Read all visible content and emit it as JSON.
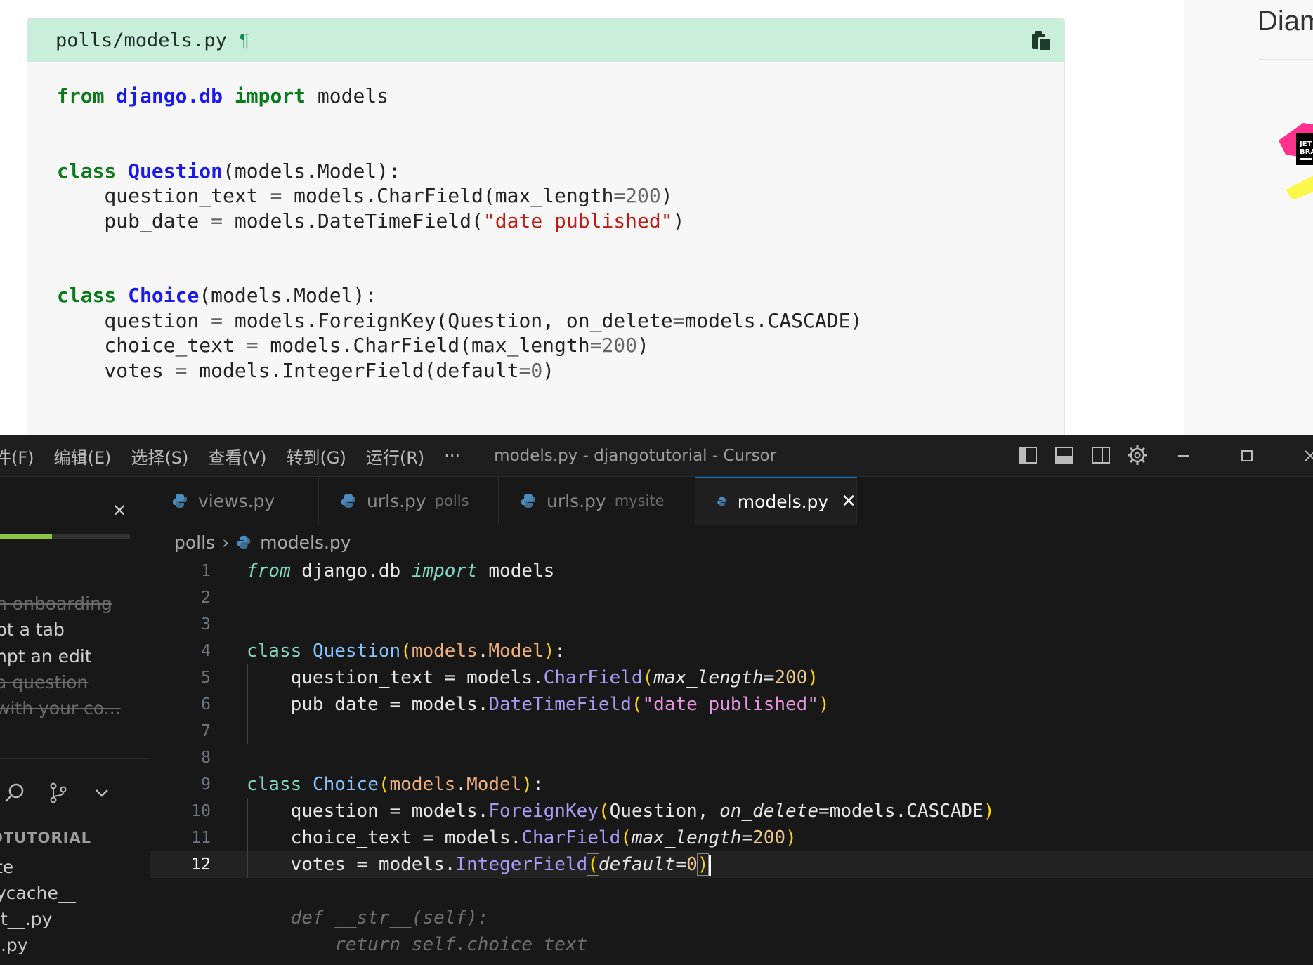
{
  "docs": {
    "snippet_filename": "polls/models.py",
    "pilcrow": "¶",
    "code_lines": [
      [
        {
          "t": "from",
          "c": "d-kw"
        },
        {
          "t": " "
        },
        {
          "t": "django.db",
          "c": "d-name"
        },
        {
          "t": " "
        },
        {
          "t": "import",
          "c": "d-kw"
        },
        {
          "t": " models"
        }
      ],
      [],
      [],
      [
        {
          "t": "class",
          "c": "d-kw"
        },
        {
          "t": " "
        },
        {
          "t": "Question",
          "c": "d-name"
        },
        {
          "t": "(models.Model):"
        }
      ],
      [
        {
          "t": "    question_text "
        },
        {
          "t": "=",
          "c": "d-op"
        },
        {
          "t": " models.CharField(max_length"
        },
        {
          "t": "=",
          "c": "d-op"
        },
        {
          "t": "200",
          "c": "d-num"
        },
        {
          "t": ")"
        }
      ],
      [
        {
          "t": "    pub_date "
        },
        {
          "t": "=",
          "c": "d-op"
        },
        {
          "t": " models.DateTimeField("
        },
        {
          "t": "\"date published\"",
          "c": "d-str"
        },
        {
          "t": ")"
        }
      ],
      [],
      [],
      [
        {
          "t": "class",
          "c": "d-kw"
        },
        {
          "t": " "
        },
        {
          "t": "Choice",
          "c": "d-name"
        },
        {
          "t": "(models.Model):"
        }
      ],
      [
        {
          "t": "    question "
        },
        {
          "t": "=",
          "c": "d-op"
        },
        {
          "t": " models.ForeignKey(Question, on_delete"
        },
        {
          "t": "=",
          "c": "d-op"
        },
        {
          "t": "models.CASCADE)"
        }
      ],
      [
        {
          "t": "    choice_text "
        },
        {
          "t": "=",
          "c": "d-op"
        },
        {
          "t": " models.CharField(max_length"
        },
        {
          "t": "=",
          "c": "d-op"
        },
        {
          "t": "200",
          "c": "d-num"
        },
        {
          "t": ")"
        }
      ],
      [
        {
          "t": "    votes "
        },
        {
          "t": "=",
          "c": "d-op"
        },
        {
          "t": " models.IntegerField(default"
        },
        {
          "t": "=",
          "c": "d-op"
        },
        {
          "t": "0",
          "c": "d-num"
        },
        {
          "t": ")"
        }
      ]
    ],
    "right_title": "Diam"
  },
  "editor": {
    "menus": [
      "件(F)",
      "编辑(E)",
      "选择(S)",
      "查看(V)",
      "转到(G)",
      "运行(R)",
      "···"
    ],
    "window_title": "models.py - djangotutorial - Cursor",
    "sidebar": {
      "onboarding": [
        {
          "label": "h onboarding",
          "done": true
        },
        {
          "label": "pt a tab",
          "done": false
        },
        {
          "label": "npt an edit",
          "done": false
        },
        {
          "label": "a question",
          "done": true
        },
        {
          "label": " with your co...",
          "done": true
        }
      ],
      "progress": 0.4,
      "explorer_title": "OTUTORIAL",
      "tree": [
        "te",
        "ycache__",
        "it__.py",
        "i.py"
      ]
    },
    "tabs": [
      {
        "label": "views.py",
        "desc": "",
        "active": false
      },
      {
        "label": "urls.py",
        "desc": "polls",
        "active": false
      },
      {
        "label": "urls.py",
        "desc": "mysite",
        "active": false
      },
      {
        "label": "models.py",
        "desc": "",
        "active": true
      }
    ],
    "tab_close": "✕",
    "breadcrumb": {
      "folder": "polls",
      "file": "models.py"
    },
    "lines": [
      {
        "n": "1",
        "segs": [
          {
            "t": "from",
            "c": "e-kw-i"
          },
          {
            "t": " django.db "
          },
          {
            "t": "import",
            "c": "e-kw-i"
          },
          {
            "t": " models"
          }
        ]
      },
      {
        "n": "2",
        "segs": []
      },
      {
        "n": "3",
        "segs": []
      },
      {
        "n": "4",
        "segs": [
          {
            "t": "class",
            "c": "e-kw"
          },
          {
            "t": " "
          },
          {
            "t": "Question",
            "c": "e-cls"
          },
          {
            "t": "(",
            "c": "e-par"
          },
          {
            "t": "models",
            "c": "e-mod"
          },
          {
            "t": "."
          },
          {
            "t": "Model",
            "c": "e-mod"
          },
          {
            "t": ")",
            "c": "e-par"
          },
          {
            "t": ":"
          }
        ]
      },
      {
        "n": "5",
        "segs": [
          {
            "t": "    question_text = models."
          },
          {
            "t": "CharField",
            "c": "e-fn"
          },
          {
            "t": "(",
            "c": "e-par"
          },
          {
            "t": "max_length",
            "c": "e-kwarg"
          },
          {
            "t": "="
          },
          {
            "t": "200",
            "c": "e-num"
          },
          {
            "t": ")",
            "c": "e-par"
          }
        ]
      },
      {
        "n": "6",
        "segs": [
          {
            "t": "    pub_date = models."
          },
          {
            "t": "DateTimeField",
            "c": "e-fn"
          },
          {
            "t": "(",
            "c": "e-par"
          },
          {
            "t": "\"date published\"",
            "c": "e-str"
          },
          {
            "t": ")",
            "c": "e-par"
          }
        ]
      },
      {
        "n": "7",
        "segs": []
      },
      {
        "n": "8",
        "segs": []
      },
      {
        "n": "9",
        "segs": [
          {
            "t": "class",
            "c": "e-kw"
          },
          {
            "t": " "
          },
          {
            "t": "Choice",
            "c": "e-cls"
          },
          {
            "t": "(",
            "c": "e-par"
          },
          {
            "t": "models",
            "c": "e-mod"
          },
          {
            "t": "."
          },
          {
            "t": "Model",
            "c": "e-mod"
          },
          {
            "t": ")",
            "c": "e-par"
          },
          {
            "t": ":"
          }
        ]
      },
      {
        "n": "10",
        "segs": [
          {
            "t": "    question = models."
          },
          {
            "t": "ForeignKey",
            "c": "e-fn"
          },
          {
            "t": "(",
            "c": "e-par"
          },
          {
            "t": "Question, "
          },
          {
            "t": "on_delete",
            "c": "e-kwarg"
          },
          {
            "t": "=models.CASCADE"
          },
          {
            "t": ")",
            "c": "e-par"
          }
        ]
      },
      {
        "n": "11",
        "segs": [
          {
            "t": "    choice_text = models."
          },
          {
            "t": "CharField",
            "c": "e-fn"
          },
          {
            "t": "(",
            "c": "e-par"
          },
          {
            "t": "max_length",
            "c": "e-kwarg"
          },
          {
            "t": "="
          },
          {
            "t": "200",
            "c": "e-num"
          },
          {
            "t": ")",
            "c": "e-par"
          }
        ]
      },
      {
        "n": "12",
        "active": true,
        "segs": [
          {
            "t": "    votes = models."
          },
          {
            "t": "IntegerField",
            "c": "e-fn"
          },
          {
            "t": "(",
            "c": "e-par bracket-box"
          },
          {
            "t": "default",
            "c": "e-kwarg"
          },
          {
            "t": "="
          },
          {
            "t": "0",
            "c": "e-num"
          },
          {
            "t": ")",
            "c": "e-par bracket-box"
          }
        ]
      },
      {
        "n": "",
        "segs": []
      },
      {
        "n": "",
        "segs": [
          {
            "t": "    def __str__(self):",
            "c": "e-ghost"
          }
        ]
      },
      {
        "n": "",
        "segs": [
          {
            "t": "        return self.choice_text",
            "c": "e-ghost"
          }
        ]
      }
    ]
  }
}
